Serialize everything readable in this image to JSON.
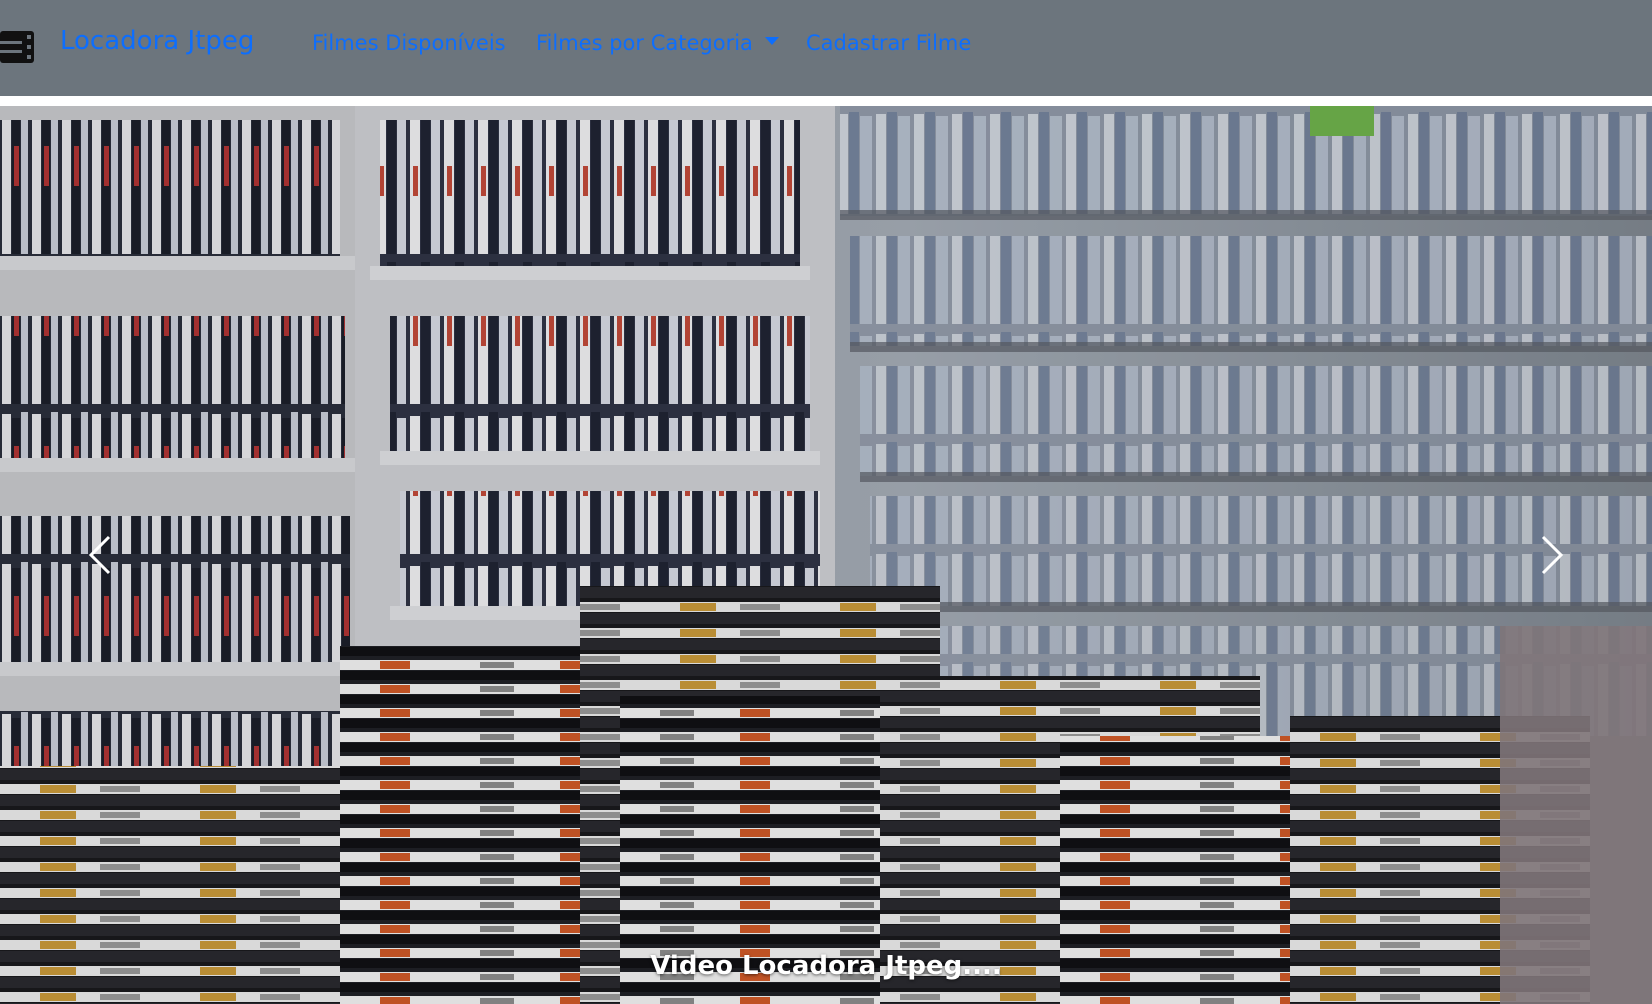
{
  "navbar": {
    "brand_icon": "film-strip-icon",
    "brand": "Locadora Jtpeg",
    "links": [
      {
        "label": "Filmes Disponíveis"
      },
      {
        "label": "Filmes por Categoria",
        "dropdown": true,
        "icon": "caret-down-icon"
      },
      {
        "label": "Cadastrar Filme"
      }
    ],
    "colors": {
      "background": "#6c757d",
      "link": "#0d6efd"
    }
  },
  "carousel": {
    "image": "video-store-dvd-shelves-photo",
    "caption": "Video Locadora Jtpeg....",
    "prev_icon": "chevron-left-icon",
    "next_icon": "chevron-right-icon"
  }
}
